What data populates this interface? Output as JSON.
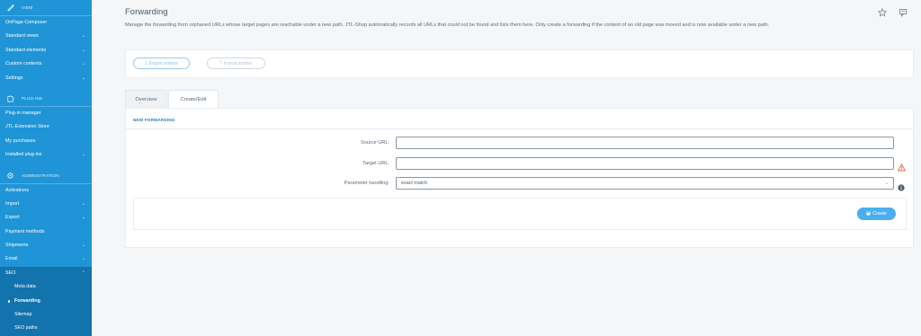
{
  "sidebar": {
    "view_section": "View",
    "view_items": [
      {
        "label": "OnPage Composer",
        "chevron": false
      },
      {
        "label": "Standard views",
        "chevron": true
      },
      {
        "label": "Standard elements",
        "chevron": true
      },
      {
        "label": "Custom contents",
        "chevron": true
      },
      {
        "label": "Settings",
        "chevron": true
      }
    ],
    "plugins_section": "Plug-ins",
    "plugin_items": [
      {
        "label": "Plug-in manager",
        "chevron": false
      },
      {
        "label": "JTL-Extension Store",
        "chevron": false
      },
      {
        "label": "My purchases",
        "chevron": false
      },
      {
        "label": "Installed plug-ins",
        "chevron": true
      }
    ],
    "admin_section": "Administration",
    "admin_items": [
      {
        "label": "Activations",
        "chevron": false
      },
      {
        "label": "Import",
        "chevron": true
      },
      {
        "label": "Export",
        "chevron": true
      },
      {
        "label": "Payment methods",
        "chevron": false
      },
      {
        "label": "Shipments",
        "chevron": true
      },
      {
        "label": "Email",
        "chevron": true
      },
      {
        "label": "SEO",
        "chevron": true
      }
    ],
    "seo_subitems": [
      {
        "label": "Meta data"
      },
      {
        "label": "Forwarding"
      },
      {
        "label": "Sitemap"
      },
      {
        "label": "SEO paths"
      }
    ]
  },
  "header": {
    "title": "Forwarding",
    "description": "Manage the forwarding from orphaned URLs whose target pages are reachable under a new path. JTL-Shop automatically records all URLs that could not be found and lists them here. Only create a forwarding if the content of an old page was moved and is now available under a new path.",
    "star_icon": "star-icon",
    "feedback_icon": "feedback-icon"
  },
  "toolbar": {
    "export_label": "Export entries",
    "import_label": "Import entries"
  },
  "tabs": [
    {
      "label": "Overview"
    },
    {
      "label": "Create/Edit"
    }
  ],
  "form": {
    "section_title": "New forwarding",
    "source_label": "Source URL:",
    "source_value": "",
    "target_label": "Target URL:",
    "target_value": "",
    "param_label": "Parameter handling:",
    "param_value": "exact match",
    "create_label": "Create"
  },
  "colors": {
    "sidebar": "#1f94d6",
    "sidebar_active": "#1373ad",
    "accent": "#4aaef0",
    "warning": "#e8532e"
  }
}
